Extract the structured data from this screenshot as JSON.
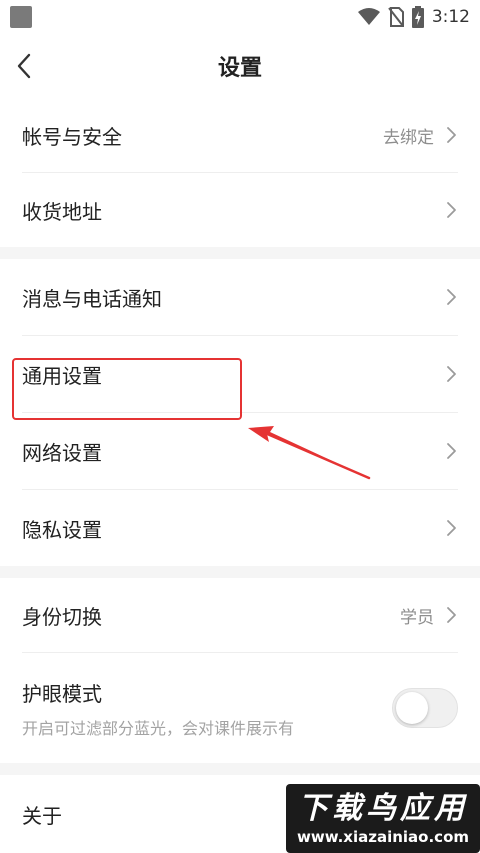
{
  "status_bar": {
    "time": "3:12"
  },
  "nav": {
    "title": "设置"
  },
  "groups": [
    {
      "items": [
        {
          "label": "帐号与安全",
          "value": "去绑定"
        },
        {
          "label": "收货地址",
          "value": ""
        }
      ]
    },
    {
      "items": [
        {
          "label": "消息与电话通知",
          "value": ""
        },
        {
          "label": "通用设置",
          "value": ""
        },
        {
          "label": "网络设置",
          "value": ""
        },
        {
          "label": "隐私设置",
          "value": ""
        }
      ]
    },
    {
      "items": [
        {
          "label": "身份切换",
          "value": "学员"
        }
      ]
    }
  ],
  "eye_mode": {
    "label": "护眼模式",
    "description": "开启可过滤部分蓝光，会对课件展示有",
    "enabled": false
  },
  "about": {
    "label": "关于"
  },
  "watermark": {
    "title": "下载鸟应用",
    "url": "www.xiazainiao.com"
  },
  "colors": {
    "highlight": "#e53333",
    "separator": "#f5f5f5"
  }
}
